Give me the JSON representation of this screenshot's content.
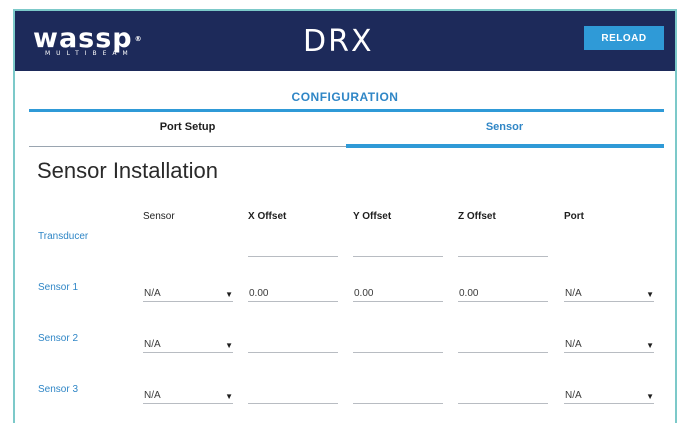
{
  "header": {
    "logo_main": "wassp",
    "logo_sub": "MULTIBEAM",
    "logo_mark": "®",
    "product": "DRX",
    "reload_label": "RELOAD"
  },
  "page_title": "CONFIGURATION",
  "tabs": [
    {
      "label": "Port Setup",
      "active": false
    },
    {
      "label": "Sensor",
      "active": true
    }
  ],
  "section_title": "Sensor Installation",
  "columns": [
    "Sensor",
    "X Offset",
    "Y Offset",
    "Z Offset",
    "Port"
  ],
  "rows": [
    {
      "label": "Transducer",
      "sensor": null,
      "x": "",
      "y": "",
      "z": "",
      "port": null
    },
    {
      "label": "Sensor 1",
      "sensor": "N/A",
      "x": "0.00",
      "y": "0.00",
      "z": "0.00",
      "port": "N/A"
    },
    {
      "label": "Sensor 2",
      "sensor": "N/A",
      "x": "",
      "y": "",
      "z": "",
      "port": "N/A"
    },
    {
      "label": "Sensor 3",
      "sensor": "N/A",
      "x": "",
      "y": "",
      "z": "",
      "port": "N/A"
    }
  ],
  "icons": {
    "dropdown": "▼"
  },
  "colors": {
    "header_bg": "#1d2a5a",
    "accent": "#2f9ad7",
    "link": "#2f86c6"
  }
}
